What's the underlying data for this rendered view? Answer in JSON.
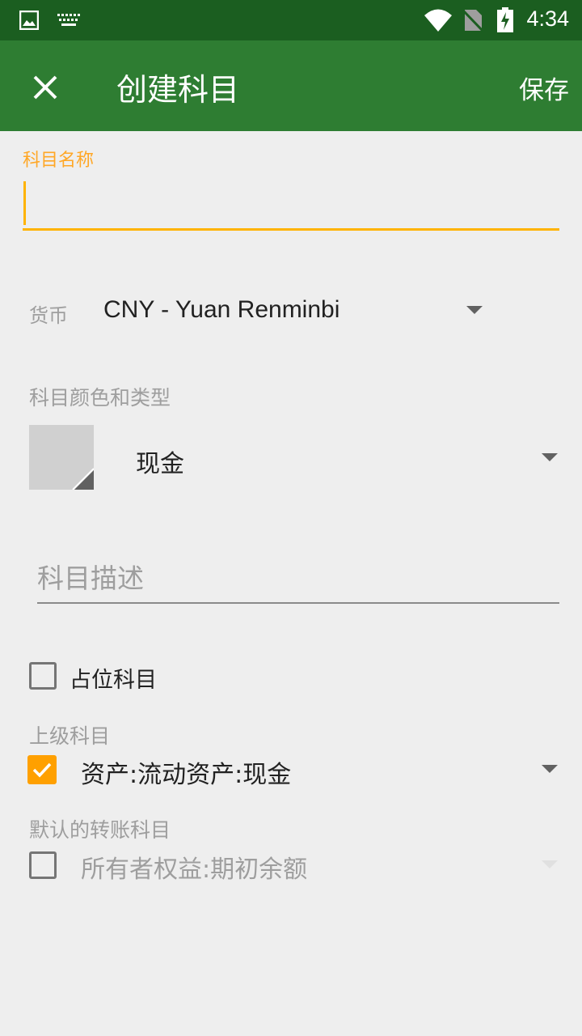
{
  "status_bar": {
    "time": "4:34",
    "icons": [
      "image-icon",
      "keyboard-icon",
      "wifi-icon",
      "no-sim-icon",
      "battery-charging-icon"
    ]
  },
  "app_bar": {
    "title": "创建科目",
    "save_label": "保存",
    "close_icon": "close-icon"
  },
  "form": {
    "name": {
      "label": "科目名称",
      "value": ""
    },
    "currency": {
      "label": "货币",
      "value": "CNY - Yuan Renminbi"
    },
    "color_type": {
      "label": "科目颜色和类型",
      "type_value": "现金",
      "swatch_color": "#d0d0d0"
    },
    "description": {
      "placeholder": "科目描述",
      "value": ""
    },
    "placeholder_account": {
      "label": "占位科目",
      "checked": false
    },
    "parent": {
      "label": "上级科目",
      "value": "资产:流动资产:现金",
      "checked": true
    },
    "default_transfer": {
      "label": "默认的转账科目",
      "value": "所有者权益:期初余额",
      "checked": false,
      "enabled": false
    }
  },
  "colors": {
    "status_bar": "#1b5e20",
    "app_bar": "#2e7d32",
    "accent": "#ffa000",
    "background": "#eeeeee"
  }
}
